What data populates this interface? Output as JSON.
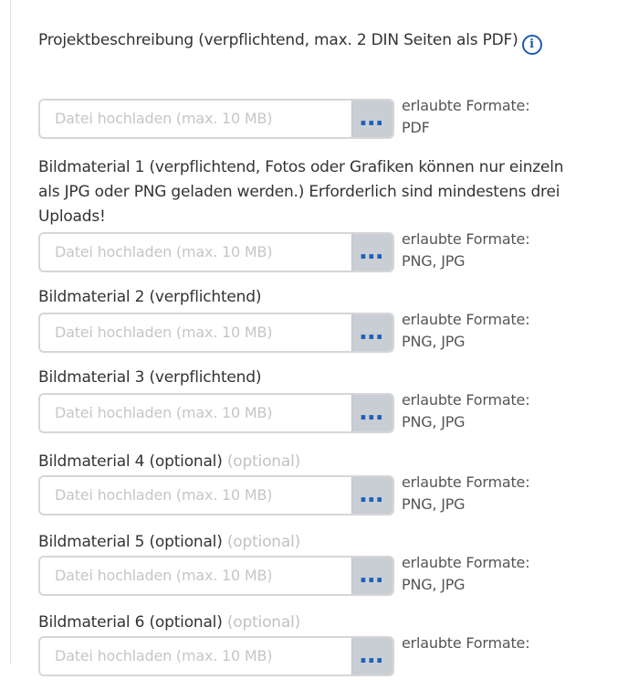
{
  "fields": [
    {
      "label": "Projektbeschreibung (verpflichtend, max. 2 DIN Seiten als PDF)",
      "optional_tag": "",
      "has_info": true,
      "placeholder": "Datei hochladen (max. 10 MB)",
      "browse_label": "...",
      "formats_label": "erlaubte Formate:",
      "formats_value": "PDF"
    },
    {
      "label": "Bildmaterial 1 (verpflichtend, Fotos oder Grafiken können nur einzeln als JPG oder PNG geladen werden.) Erforderlich sind mindestens drei Uploads!",
      "optional_tag": "",
      "has_info": false,
      "placeholder": "Datei hochladen (max. 10 MB)",
      "browse_label": "...",
      "formats_label": "erlaubte Formate:",
      "formats_value": "PNG, JPG"
    },
    {
      "label": "Bildmaterial 2 (verpflichtend)",
      "optional_tag": "",
      "has_info": false,
      "placeholder": "Datei hochladen (max. 10 MB)",
      "browse_label": "...",
      "formats_label": "erlaubte Formate:",
      "formats_value": "PNG, JPG"
    },
    {
      "label": "Bildmaterial 3 (verpflichtend)",
      "optional_tag": "",
      "has_info": false,
      "placeholder": "Datei hochladen (max. 10 MB)",
      "browse_label": "...",
      "formats_label": "erlaubte Formate:",
      "formats_value": "PNG, JPG"
    },
    {
      "label": "Bildmaterial 4 (optional)",
      "optional_tag": "(optional)",
      "has_info": false,
      "placeholder": "Datei hochladen (max. 10 MB)",
      "browse_label": "...",
      "formats_label": "erlaubte Formate:",
      "formats_value": "PNG, JPG"
    },
    {
      "label": "Bildmaterial 5 (optional)",
      "optional_tag": "(optional)",
      "has_info": false,
      "placeholder": "Datei hochladen (max. 10 MB)",
      "browse_label": "...",
      "formats_label": "erlaubte Formate:",
      "formats_value": "PNG, JPG"
    },
    {
      "label": "Bildmaterial 6 (optional)",
      "optional_tag": "(optional)",
      "has_info": false,
      "placeholder": "Datei hochladen (max. 10 MB)",
      "browse_label": "...",
      "formats_label": "erlaubte Formate:",
      "formats_value": ""
    }
  ],
  "info_icon_glyph": "i",
  "colors": {
    "accent": "#1f5fb8",
    "browse_bg": "#c9cdd4",
    "input_border": "#d6d6d6",
    "placeholder": "#c6c6c6",
    "optional": "#c2c2c2"
  }
}
